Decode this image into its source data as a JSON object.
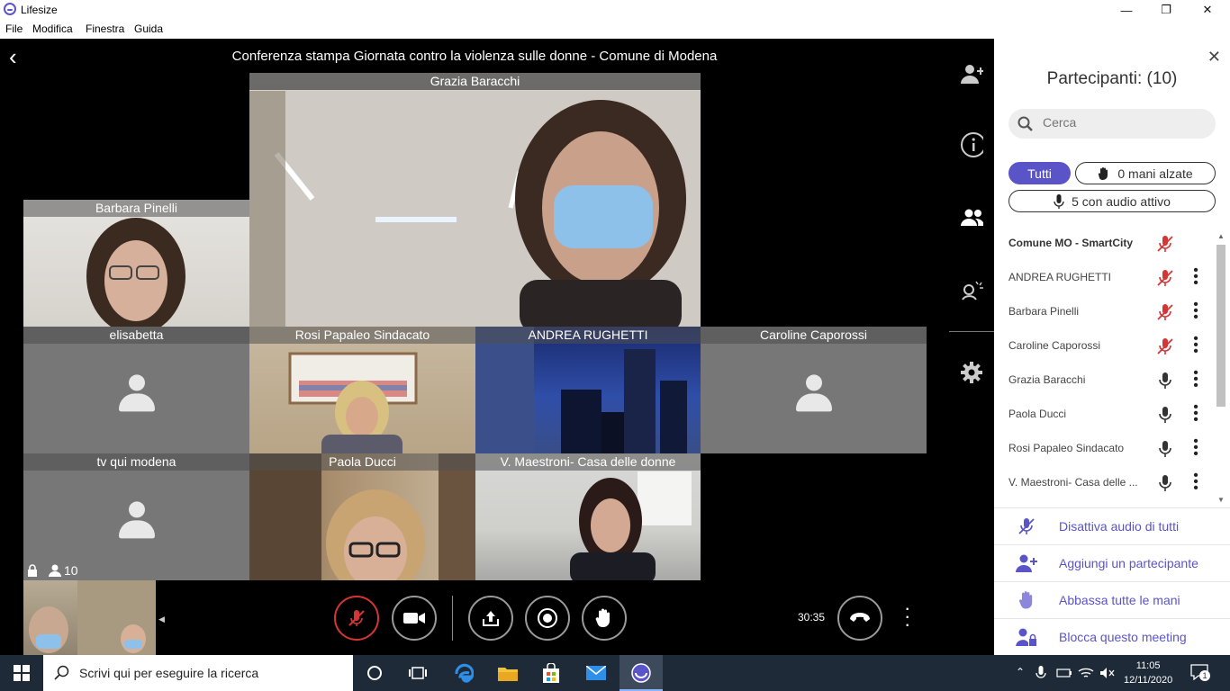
{
  "window": {
    "title": "Lifesize",
    "minimize": "—",
    "restore": "❐",
    "close": "✕"
  },
  "menu": [
    "File",
    "Modifica",
    "Finestra",
    "Guida"
  ],
  "meeting": {
    "title": "Conferenza stampa Giornata contro la violenza sulle donne - Comune di Modena",
    "timer": "30:35",
    "participant_count": "10"
  },
  "tiles": {
    "grazia": "Grazia Baracchi",
    "barbara": "Barbara Pinelli",
    "elisabetta": "elisabetta",
    "rosi": "Rosi Papaleo Sindacato",
    "andrea": "ANDREA RUGHETTI",
    "caroline": "Caroline Caporossi",
    "tvqui": "tv qui modena",
    "paola": "Paola Ducci",
    "maestroni": "V. Maestroni- Casa delle donne"
  },
  "panel": {
    "title": "Partecipanti: (10)",
    "search_placeholder": "Cerca",
    "filter_all": "Tutti",
    "filter_hands": "0 mani alzate",
    "filter_audio": "5 con audio attivo",
    "participants": [
      {
        "name": "Comune MO - SmartCity",
        "muted": true,
        "menu": false
      },
      {
        "name": "ANDREA RUGHETTI",
        "muted": true,
        "menu": true
      },
      {
        "name": "Barbara Pinelli",
        "muted": true,
        "menu": true
      },
      {
        "name": "Caroline Caporossi",
        "muted": true,
        "menu": true
      },
      {
        "name": "Grazia Baracchi",
        "muted": false,
        "menu": true
      },
      {
        "name": "Paola Ducci",
        "muted": false,
        "menu": true
      },
      {
        "name": "Rosi Papaleo Sindacato",
        "muted": false,
        "menu": true
      },
      {
        "name": "V. Maestroni- Casa delle ...",
        "muted": false,
        "menu": true
      }
    ],
    "actions": {
      "mute_all": "Disattiva audio di tutti",
      "add": "Aggiungi un partecipante",
      "lower_hands": "Abbassa tutte le mani",
      "lock": "Blocca questo meeting"
    }
  },
  "taskbar": {
    "search_text": "Scrivi qui per eseguire la ricerca",
    "time": "11:05",
    "date": "12/11/2020",
    "notifications": "1"
  },
  "colors": {
    "accent": "#5a54c8",
    "muted_red": "#d63535"
  }
}
